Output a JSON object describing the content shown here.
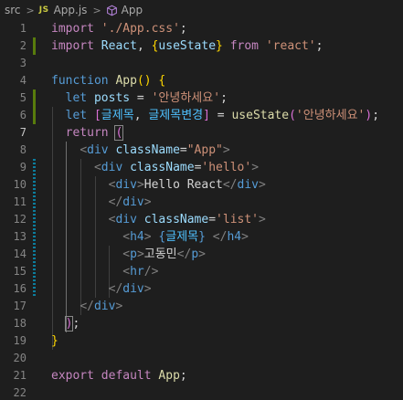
{
  "breadcrumb": {
    "folder": "src",
    "file_badge": "JS",
    "file": "App.js",
    "symbol": "App",
    "separator": ">"
  },
  "lines": [
    {
      "n": "1",
      "tokens": [
        [
          "kw",
          "import"
        ],
        [
          "txt",
          " "
        ],
        [
          "str",
          "'./App.css'"
        ],
        [
          "txt",
          ";"
        ]
      ]
    },
    {
      "n": "2",
      "tokens": [
        [
          "kw",
          "import"
        ],
        [
          "txt",
          " "
        ],
        [
          "var",
          "React"
        ],
        [
          "txt",
          ", "
        ],
        [
          "brk",
          "{"
        ],
        [
          "var",
          "useState"
        ],
        [
          "brk",
          "}"
        ],
        [
          "txt",
          " "
        ],
        [
          "kw",
          "from"
        ],
        [
          "txt",
          " "
        ],
        [
          "str",
          "'react'"
        ],
        [
          "txt",
          ";"
        ]
      ]
    },
    {
      "n": "3",
      "tokens": []
    },
    {
      "n": "4",
      "tokens": [
        [
          "st",
          "function"
        ],
        [
          "txt",
          " "
        ],
        [
          "fn",
          "App"
        ],
        [
          "brk",
          "("
        ],
        [
          "brk",
          ")"
        ],
        [
          "txt",
          " "
        ],
        [
          "brk",
          "{"
        ]
      ]
    },
    {
      "n": "5",
      "tokens": [
        [
          "txt",
          "  "
        ],
        [
          "st",
          "let"
        ],
        [
          "txt",
          " "
        ],
        [
          "var",
          "posts"
        ],
        [
          "txt",
          " = "
        ],
        [
          "str",
          "'안녕하세요'"
        ],
        [
          "txt",
          ";"
        ]
      ]
    },
    {
      "n": "6",
      "tokens": [
        [
          "txt",
          "  "
        ],
        [
          "st",
          "let"
        ],
        [
          "txt",
          " "
        ],
        [
          "brk2",
          "["
        ],
        [
          "const",
          "글제목"
        ],
        [
          "txt",
          ", "
        ],
        [
          "const",
          "글제목변경"
        ],
        [
          "brk2",
          "]"
        ],
        [
          "txt",
          " = "
        ],
        [
          "fn",
          "useState"
        ],
        [
          "brk2",
          "("
        ],
        [
          "str",
          "'안녕하세요'"
        ],
        [
          "brk2",
          ")"
        ],
        [
          "txt",
          ";"
        ]
      ]
    },
    {
      "n": "7",
      "tokens": [
        [
          "txt",
          "  "
        ],
        [
          "kw",
          "return"
        ],
        [
          "txt",
          " "
        ],
        [
          "brk2b",
          "("
        ]
      ]
    },
    {
      "n": "8",
      "tokens": [
        [
          "txt",
          "    "
        ],
        [
          "punct",
          "<"
        ],
        [
          "tag",
          "div"
        ],
        [
          "txt",
          " "
        ],
        [
          "var",
          "className"
        ],
        [
          "txt",
          "="
        ],
        [
          "str",
          "\"App\""
        ],
        [
          "punct",
          ">"
        ]
      ]
    },
    {
      "n": "9",
      "tokens": [
        [
          "txt",
          "      "
        ],
        [
          "punct",
          "<"
        ],
        [
          "tag",
          "div"
        ],
        [
          "txt",
          " "
        ],
        [
          "var",
          "className"
        ],
        [
          "txt",
          "="
        ],
        [
          "str",
          "'hello'"
        ],
        [
          "punct",
          ">"
        ]
      ]
    },
    {
      "n": "10",
      "tokens": [
        [
          "txt",
          "        "
        ],
        [
          "punct",
          "<"
        ],
        [
          "tag",
          "div"
        ],
        [
          "punct",
          ">"
        ],
        [
          "txt",
          "Hello React"
        ],
        [
          "punct",
          "</"
        ],
        [
          "tag",
          "div"
        ],
        [
          "punct",
          ">"
        ]
      ]
    },
    {
      "n": "11",
      "tokens": [
        [
          "txt",
          "        "
        ],
        [
          "punct",
          "</"
        ],
        [
          "tag",
          "div"
        ],
        [
          "punct",
          ">"
        ]
      ]
    },
    {
      "n": "12",
      "tokens": [
        [
          "txt",
          "        "
        ],
        [
          "punct",
          "<"
        ],
        [
          "tag",
          "div"
        ],
        [
          "txt",
          " "
        ],
        [
          "var",
          "className"
        ],
        [
          "txt",
          "="
        ],
        [
          "str",
          "'list'"
        ],
        [
          "punct",
          ">"
        ]
      ]
    },
    {
      "n": "13",
      "tokens": [
        [
          "txt",
          "          "
        ],
        [
          "punct",
          "<"
        ],
        [
          "tag",
          "h4"
        ],
        [
          "punct",
          ">"
        ],
        [
          "txt",
          " "
        ],
        [
          "st",
          "{"
        ],
        [
          "const",
          "글제목"
        ],
        [
          "st",
          "}"
        ],
        [
          "txt",
          " "
        ],
        [
          "punct",
          "</"
        ],
        [
          "tag",
          "h4"
        ],
        [
          "punct",
          ">"
        ]
      ]
    },
    {
      "n": "14",
      "tokens": [
        [
          "txt",
          "          "
        ],
        [
          "punct",
          "<"
        ],
        [
          "tag",
          "p"
        ],
        [
          "punct",
          ">"
        ],
        [
          "txt",
          "고동민"
        ],
        [
          "punct",
          "</"
        ],
        [
          "tag",
          "p"
        ],
        [
          "punct",
          ">"
        ]
      ]
    },
    {
      "n": "15",
      "tokens": [
        [
          "txt",
          "          "
        ],
        [
          "punct",
          "<"
        ],
        [
          "tag",
          "hr"
        ],
        [
          "punct",
          "/>"
        ]
      ]
    },
    {
      "n": "16",
      "tokens": [
        [
          "txt",
          "        "
        ],
        [
          "punct",
          "</"
        ],
        [
          "tag",
          "div"
        ],
        [
          "punct",
          ">"
        ]
      ]
    },
    {
      "n": "17",
      "tokens": [
        [
          "txt",
          "    "
        ],
        [
          "punct",
          "</"
        ],
        [
          "tag",
          "div"
        ],
        [
          "punct",
          ">"
        ]
      ]
    },
    {
      "n": "18",
      "tokens": [
        [
          "txt",
          "  "
        ],
        [
          "brk2b",
          ")"
        ],
        [
          "txt",
          ";"
        ]
      ]
    },
    {
      "n": "19",
      "tokens": [
        [
          "brk",
          "}"
        ]
      ]
    },
    {
      "n": "20",
      "tokens": []
    },
    {
      "n": "21",
      "tokens": [
        [
          "kw",
          "export"
        ],
        [
          "txt",
          " "
        ],
        [
          "kw",
          "default"
        ],
        [
          "txt",
          " "
        ],
        [
          "fn",
          "App"
        ],
        [
          "txt",
          ";"
        ]
      ]
    },
    {
      "n": "22",
      "tokens": []
    }
  ],
  "active_line": "7",
  "colors": {
    "background": "#1e1e1e",
    "keyword_control": "#c586c0",
    "keyword_storage": "#569cd6",
    "function": "#dcdcaa",
    "variable": "#9cdcfe",
    "constant": "#4fc1ff",
    "string": "#ce9178",
    "bracket_level1": "#ffd700",
    "bracket_level2": "#da70d6",
    "gutter_added": "#587c0c",
    "gutter_modified": "#0c7d9d"
  }
}
